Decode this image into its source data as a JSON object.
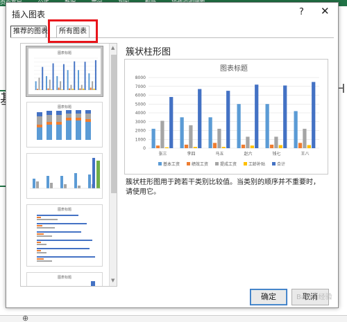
{
  "excel_bg": {
    "ribbon_items": [
      "页面布局",
      "公式",
      "数据",
      "审阅",
      "视图",
      "帮助",
      "操作说明搜索"
    ],
    "cell_fragment": "基本",
    "col_fragment": "H"
  },
  "dialog": {
    "title": "插入图表",
    "help": "?",
    "close": "✕",
    "tabs": [
      "推荐的图表",
      "所有图表"
    ],
    "ok": "确定",
    "cancel": "取消"
  },
  "preview": {
    "heading": "簇状柱形图",
    "description": "簇状柱形图用于跨若干类别比较值。当类别的顺序并不重要时，请使用它。"
  },
  "chart_data": {
    "type": "bar",
    "title": "图表标题",
    "categories": [
      "张三",
      "李四",
      "马五",
      "赵六",
      "钱七",
      "王八"
    ],
    "ylim": [
      0,
      8000
    ],
    "yticks": [
      0,
      1000,
      2000,
      3000,
      4000,
      5000,
      6000,
      7000,
      8000
    ],
    "legend_position": "bottom",
    "grid": true,
    "series": [
      {
        "name": "基本工资",
        "color": "#5b9bd5",
        "values": [
          2200,
          3500,
          3500,
          5000,
          5000,
          4200
        ]
      },
      {
        "name": "绩效工资",
        "color": "#ed7d31",
        "values": [
          300,
          400,
          600,
          400,
          400,
          600
        ]
      },
      {
        "name": "提成工资",
        "color": "#a5a5a5",
        "values": [
          3100,
          2600,
          2200,
          1300,
          1300,
          2200
        ]
      },
      {
        "name": "工龄补贴",
        "color": "#ffc000",
        "values": [
          100,
          150,
          150,
          300,
          350,
          350
        ]
      },
      {
        "name": "合计",
        "color": "#4472c4",
        "values": [
          5800,
          6700,
          6500,
          7200,
          7100,
          7500
        ]
      }
    ]
  },
  "watermark": "Baidu 经验"
}
